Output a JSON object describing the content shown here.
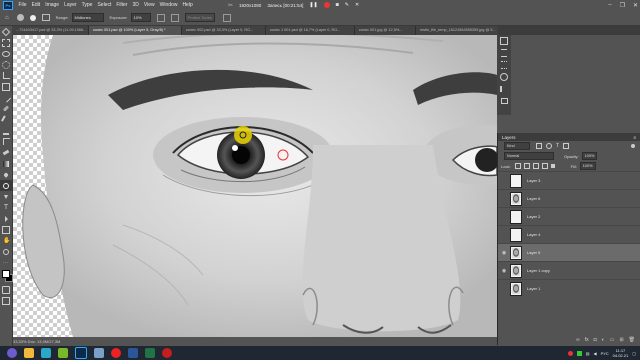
{
  "menu": [
    "File",
    "Edit",
    "Image",
    "Layer",
    "Type",
    "Select",
    "Filter",
    "3D",
    "View",
    "Window",
    "Help"
  ],
  "recorder": {
    "resolution": "1920x1080",
    "title": "Запись [00:21:54]"
  },
  "options": {
    "range_label": "Range:",
    "range_value": "Midtones",
    "exposure_label": "Exposure:",
    "exposure_value": "10%",
    "protect_label": "Protect Tones"
  },
  "tabs": [
    "...724403417.psd @ 33,3% (11.09.1966...",
    "колес 001.psd @ 100% (Layer 5, Gray/8) *",
    "колес 002.psd @ 33,3% (Layer 0, RG...",
    "колес 1 001.psd @ 16,7% (Layer 0, RG...",
    "колес 001.jpg @ 12,5%...",
    "mstin_file_temp_16124564555359.jpg @ 5..."
  ],
  "status": "33,33%     Doc: 13,0M/27,3M",
  "layers_panel": {
    "title": "Layers",
    "kind_label": "Kind",
    "opacity_label": "Opacity:",
    "opacity_value": "100%",
    "blend_mode": "Normal",
    "lock_label": "Lock:",
    "fill_label": "Fill:",
    "fill_value": "100%",
    "layers": [
      {
        "name": "Layer 3",
        "visible": false,
        "selected": false,
        "thumb": "blank"
      },
      {
        "name": "Layer 6",
        "visible": false,
        "selected": false,
        "thumb": "face"
      },
      {
        "name": "Layer 2",
        "visible": false,
        "selected": false,
        "thumb": "blank"
      },
      {
        "name": "Layer 4",
        "visible": false,
        "selected": false,
        "thumb": "blank"
      },
      {
        "name": "Layer 5",
        "visible": true,
        "selected": true,
        "thumb": "face"
      },
      {
        "name": "Layer 1 copy",
        "visible": true,
        "selected": false,
        "thumb": "face"
      },
      {
        "name": "Layer 1",
        "visible": false,
        "selected": false,
        "thumb": "face"
      }
    ]
  },
  "tray": {
    "lang": "РУС",
    "time": "11:17",
    "date": "04.02.21"
  },
  "colors": {
    "accent": "#31a8ff",
    "panel": "#535353",
    "dark": "#3c3c3c",
    "taskbar": "#1f2733",
    "highlight": "#e8d200"
  }
}
